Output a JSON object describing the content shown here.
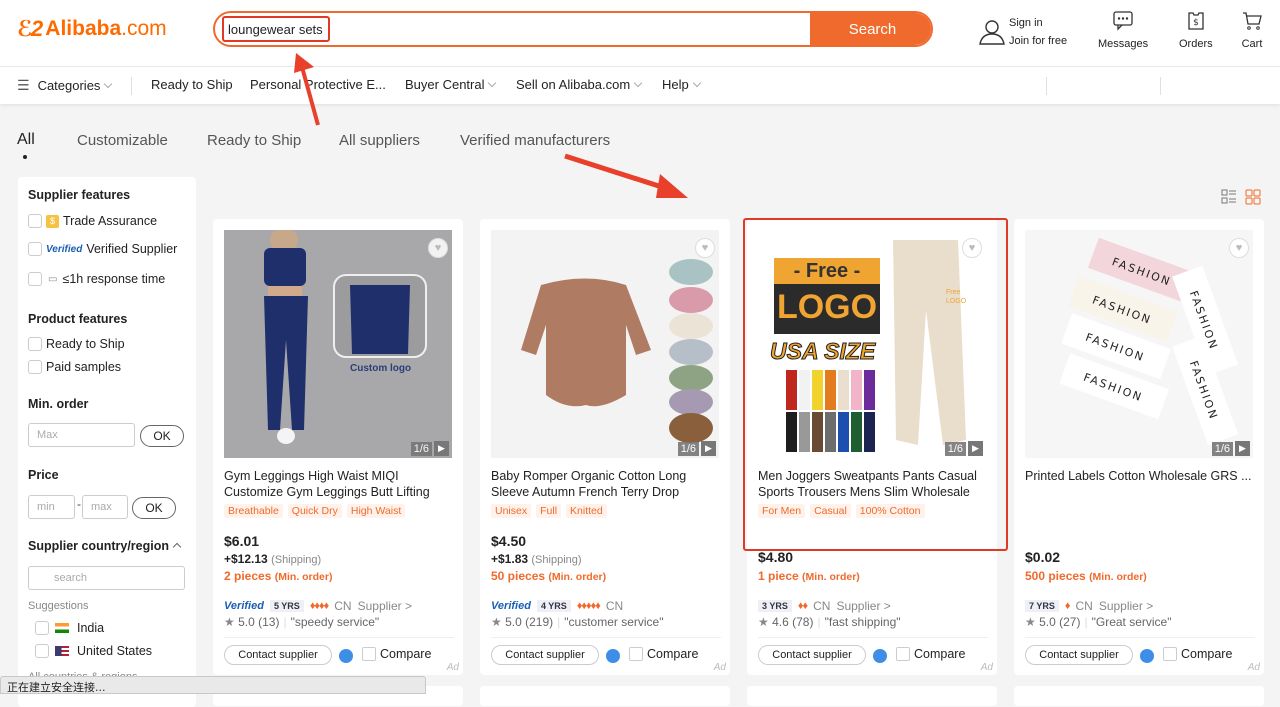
{
  "header": {
    "logo_text": "Alibaba",
    "logo_suffix": ".com",
    "search_value": "loungewear sets",
    "search_button": "Search",
    "sign_in": "Sign in",
    "join": "Join for free",
    "messages": "Messages",
    "orders": "Orders",
    "cart": "Cart"
  },
  "nav": {
    "categories": "Categories",
    "items": [
      "Ready to Ship",
      "Personal Protective E...",
      "Buyer Central",
      "Sell on Alibaba.com",
      "Help"
    ]
  },
  "tabs": [
    "All",
    "Customizable",
    "Ready to Ship",
    "All suppliers",
    "Verified manufacturers"
  ],
  "sidebar": {
    "supplier_features_title": "Supplier features",
    "trade_assurance": "Trade Assurance",
    "verified_badge": "Verified",
    "verified_supplier": "Verified Supplier",
    "response_time": "≤1h response time",
    "product_features_title": "Product features",
    "ready_to_ship": "Ready to Ship",
    "paid_samples": "Paid samples",
    "min_order_title": "Min. order",
    "min_order_placeholder": "Max",
    "ok": "OK",
    "price_title": "Price",
    "price_min_placeholder": "min",
    "price_max_placeholder": "max",
    "dash": "-",
    "country_title": "Supplier country/region",
    "country_search_placeholder": "search",
    "suggestions": "Suggestions",
    "countries": [
      "India",
      "United States"
    ],
    "all_countries": "All countries & regions"
  },
  "products": [
    {
      "title": "Gym Leggings High Waist MIQI Customize Gym Leggings Butt Lifting",
      "chips": [
        "Breathable",
        "Quick Dry",
        "High Waist"
      ],
      "price": "$6.01",
      "shipping": "+$12.13",
      "shipping_label": "(Shipping)",
      "moq": "2 pieces",
      "moq_label": "(Min. order)",
      "verified": "Verified",
      "years": "5 YRS",
      "diamonds": "♦♦♦♦",
      "country": "CN",
      "supplier": "Supplier >",
      "rating": "5.0",
      "reviews": "(13)",
      "review_tag": "\"speedy service\"",
      "counter": "1/6"
    },
    {
      "title": "Baby Romper Organic Cotton Long Sleeve Autumn French Terry Drop",
      "chips": [
        "Unisex",
        "Full",
        "Knitted"
      ],
      "price": "$4.50",
      "shipping": "+$1.83",
      "shipping_label": "(Shipping)",
      "moq": "50 pieces",
      "moq_label": "(Min. order)",
      "verified": "Verified",
      "years": "4 YRS",
      "diamonds": "♦♦♦♦♦",
      "country": "CN",
      "supplier": "",
      "rating": "5.0",
      "reviews": "(219)",
      "review_tag": "\"customer service\"",
      "counter": "1/6"
    },
    {
      "title": "Men Joggers Sweatpants Pants Casual Sports Trousers Mens Slim Wholesale",
      "chips": [
        "For Men",
        "Casual",
        "100% Cotton"
      ],
      "price": "$4.80",
      "shipping": "",
      "shipping_label": "",
      "moq": "1 piece",
      "moq_label": "(Min. order)",
      "verified": "",
      "years": "3 YRS",
      "diamonds": "♦♦",
      "country": "CN",
      "supplier": "Supplier >",
      "rating": "4.6",
      "reviews": "(78)",
      "review_tag": "\"fast shipping\"",
      "counter": "1/6",
      "image_text": {
        "free": "- Free -",
        "logo": "LOGO",
        "usa": "USA SIZE",
        "pant_logo": "Free LOGO"
      }
    },
    {
      "title": "Printed Labels Cotton Wholesale GRS ...",
      "chips": [],
      "price": "$0.02",
      "shipping": "",
      "shipping_label": "",
      "moq": "500 pieces",
      "moq_label": "(Min. order)",
      "verified": "",
      "years": "7 YRS",
      "diamonds": "♦",
      "country": "CN",
      "supplier": "Supplier >",
      "rating": "5.0",
      "reviews": "(27)",
      "review_tag": "\"Great service\"",
      "counter": "1/6",
      "image_text": "FASHION"
    }
  ],
  "product_common": {
    "contact": "Contact supplier",
    "compare": "Compare",
    "ad": "Ad",
    "custom_logo": "Custom logo"
  },
  "status_bar": "正在建立安全连接...",
  "colors": {
    "accent": "#ef6a2c",
    "annotation": "#e03a26",
    "verified": "#1a5fb4"
  }
}
